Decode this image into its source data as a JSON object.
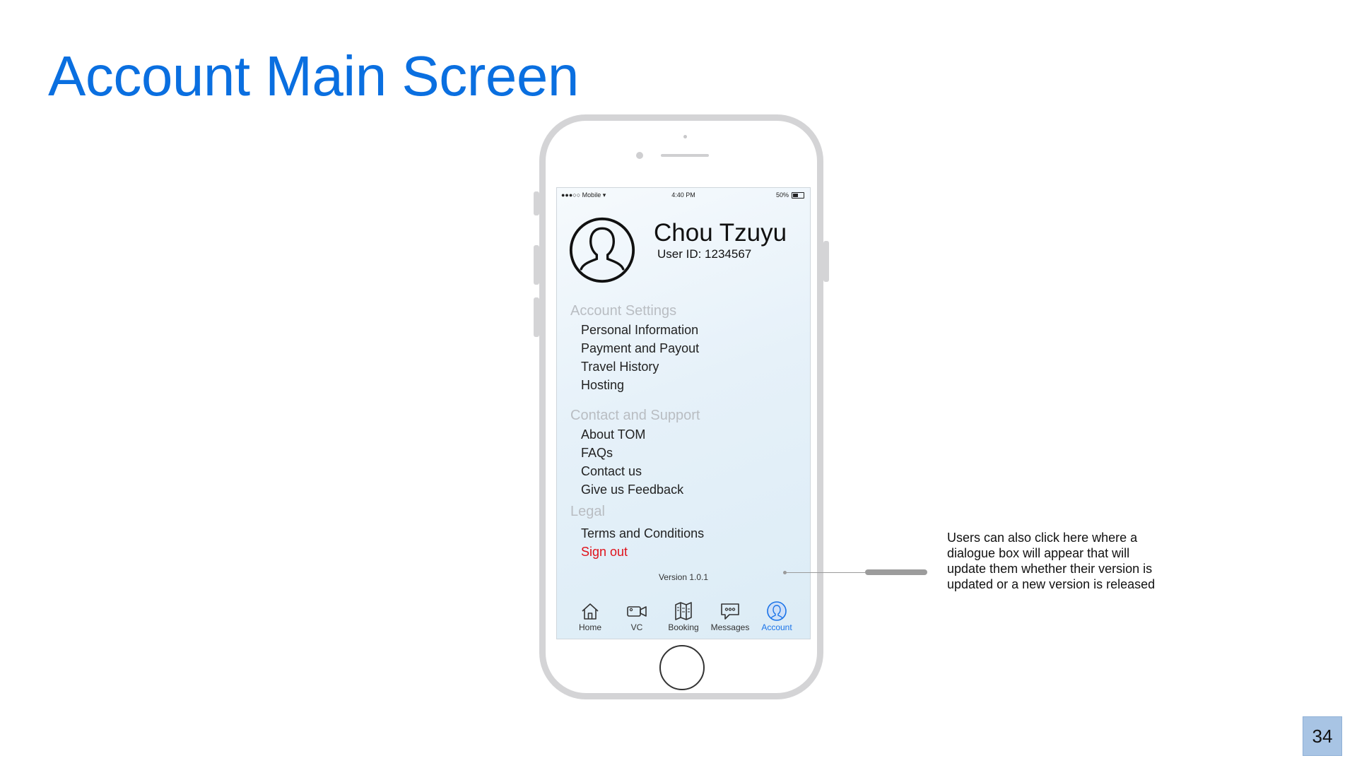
{
  "slide": {
    "title": "Account Main Screen",
    "page_number": "34",
    "annotation": "Users can also click here where a dialogue box will appear that will update them whether their version is updated or a new version is released"
  },
  "status_bar": {
    "carrier": "●●●○○ Mobile ▾",
    "time": "4:40 PM",
    "battery": "50%",
    "battery_level": 0.5
  },
  "profile": {
    "name": "Chou Tzuyu",
    "user_id": "User ID: 1234567"
  },
  "sections": {
    "account_settings": {
      "title": "Account Settings",
      "items": [
        "Personal Information",
        "Payment and Payout",
        "Travel History",
        "Hosting"
      ]
    },
    "contact_support": {
      "title": "Contact and Support",
      "items": [
        "About TOM",
        "FAQs",
        "Contact us",
        "Give us Feedback"
      ]
    },
    "legal": {
      "title": "Legal",
      "items": [
        "Terms and Conditions"
      ]
    },
    "sign_out": "Sign out"
  },
  "version": "Version 1.0.1",
  "tabs": [
    {
      "label": "Home",
      "icon": "home-icon"
    },
    {
      "label": "VC",
      "icon": "video-camera-icon"
    },
    {
      "label": "Booking",
      "icon": "map-icon"
    },
    {
      "label": "Messages",
      "icon": "chat-bubble-icon"
    },
    {
      "label": "Account",
      "icon": "user-icon",
      "active": true
    }
  ],
  "colors": {
    "title": "#0a6fe0",
    "active_tab": "#1a73e8",
    "sign_out": "#e0121b",
    "section_title": "#b9bdc2",
    "page_number_bg": "#a8c4e4"
  }
}
